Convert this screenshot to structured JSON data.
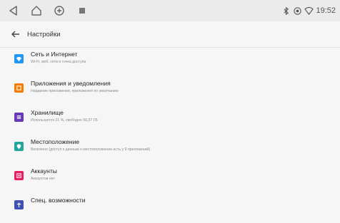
{
  "status_bar": {
    "nav_icons": [
      "back-icon",
      "home-icon",
      "recents-icon",
      "app-icon"
    ],
    "right_icons": [
      "bluetooth-icon",
      "location-icon",
      "wifi-icon"
    ],
    "time": "19:52"
  },
  "app_bar": {
    "back_icon": "arrow-back-icon",
    "title": "Настройки"
  },
  "settings": {
    "items": [
      {
        "title": "Сеть и Интернет",
        "subtitle": "Wi-Fi, моб. сети и точка доступа",
        "icon": "wifi-icon",
        "color": "#2196f3"
      },
      {
        "title": "Приложения и уведомления",
        "subtitle": "Недавние приложения, приложения по умолчанию",
        "icon": "apps-icon",
        "color": "#f57c00"
      },
      {
        "title": "Хранилище",
        "subtitle": "Используется 21 %, свободно 50,37 ГБ",
        "icon": "storage-icon",
        "color": "#673ab7"
      },
      {
        "title": "Местоположение",
        "subtitle": "Включено (доступ к данным о местоположении есть у 9 приложений)",
        "icon": "location-icon",
        "color": "#26a69a"
      },
      {
        "title": "Аккаунты",
        "subtitle": "Аккаунтов нет",
        "icon": "account-icon",
        "color": "#e91e63"
      },
      {
        "title": "Спец. возможности",
        "subtitle": "",
        "icon": "accessibility-icon",
        "color": "#3f51b5"
      }
    ]
  }
}
